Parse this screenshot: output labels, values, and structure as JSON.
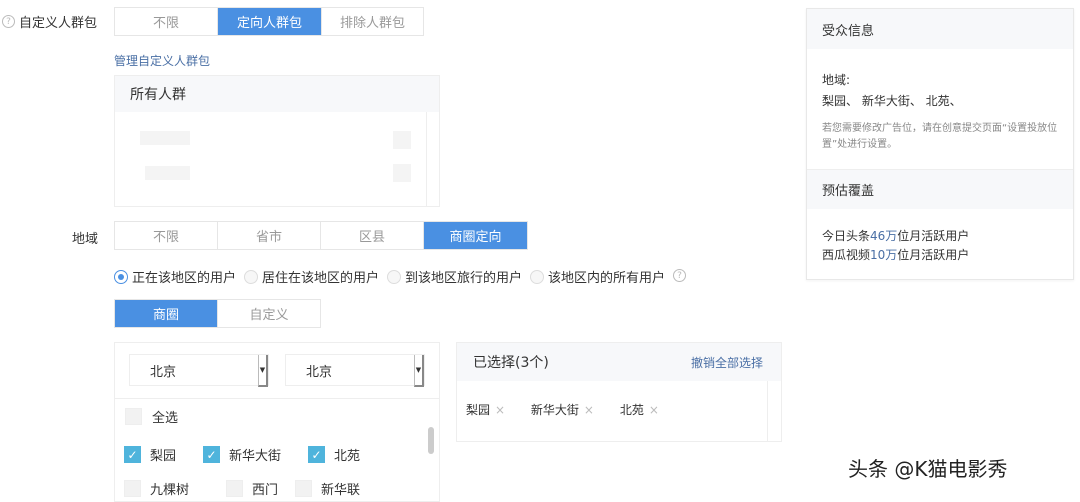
{
  "custom_audience": {
    "label": "自定义人群包",
    "options": [
      "不限",
      "定向人群包",
      "排除人群包"
    ],
    "selected": 1,
    "manage_link": "管理自定义人群包",
    "list_header": "所有人群"
  },
  "region": {
    "label": "地域",
    "options": [
      "不限",
      "省市",
      "区县",
      "商圈定向"
    ],
    "selected": 3,
    "radios": [
      "正在该地区的用户",
      "居住在该地区的用户",
      "到该地区旅行的用户",
      "该地区内的所有用户"
    ],
    "radio_selected": 0,
    "sub_tabs": [
      "商圈",
      "自定义"
    ],
    "sub_selected": 0,
    "province": "北京",
    "city": "北京",
    "select_all": "全选",
    "items": [
      {
        "name": "梨园",
        "checked": true
      },
      {
        "name": "新华大街",
        "checked": true
      },
      {
        "name": "北苑",
        "checked": true
      },
      {
        "name": "九棵树",
        "checked": false
      },
      {
        "name": "西门",
        "checked": false
      },
      {
        "name": "新华联",
        "checked": false
      }
    ],
    "selected_title": "已选择(3个)",
    "clear_all": "撤销全部选择",
    "selected_tags": [
      "梨园",
      "新华大街",
      "北苑"
    ]
  },
  "audience_info": {
    "title": "受众信息",
    "region_label": "地域:",
    "region_value": "梨园、 新华大街、 北苑、",
    "note": "若您需要修改广告位，请在创意提交页面“设置投放位置”处进行设置。",
    "coverage_title": "预估覆盖",
    "coverage": [
      {
        "prefix": "今日头条",
        "num": "46万",
        "suffix": "位月活跃用户"
      },
      {
        "prefix": "西瓜视频",
        "num": "10万",
        "suffix": "位月活跃用户"
      }
    ]
  },
  "watermark": "头条 @K猫电影秀",
  "colors": {
    "accent": "#4a90e2",
    "check": "#4fb4dc"
  }
}
